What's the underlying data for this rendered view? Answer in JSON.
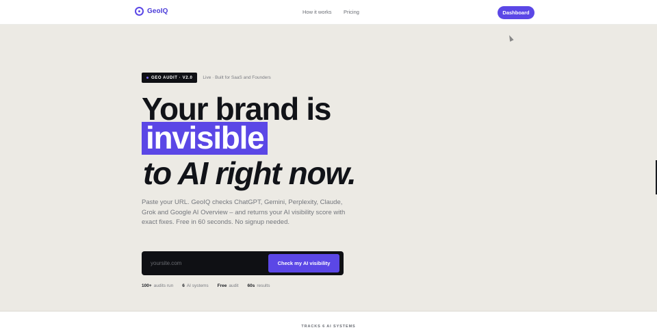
{
  "nav": {
    "brand": "GeoIQ",
    "links": [
      "How it works",
      "Pricing"
    ],
    "cta": "Dashboard"
  },
  "hero": {
    "badge": "GEO AUDIT · V2.0",
    "badge_note": "Live · Built for SaaS and Founders",
    "headline_line1": "Your brand is",
    "headline_highlight": "invisible",
    "headline_line3": "to AI right now.",
    "subtext": "Paste your URL. GeoIQ checks ChatGPT, Gemini, Perplexity, Claude, Grok and Google AI Overview – and returns your AI visibility score with exact fixes. Free in 60 seconds. No signup needed.",
    "input_placeholder": "yoursite.com",
    "input_value": "",
    "submit_label": "Check my AI visibility",
    "stats": [
      {
        "value": "100+",
        "label": "audits run"
      },
      {
        "value": "6",
        "label": "AI systems"
      },
      {
        "value": "Free",
        "label": "audit"
      },
      {
        "value": "60s",
        "label": "results"
      }
    ]
  },
  "section_label": "TRACKS 6 AI SYSTEMS",
  "colors": {
    "accent": "#5b47e6",
    "hero_bg": "#eceae4",
    "dark": "#0f1014"
  }
}
